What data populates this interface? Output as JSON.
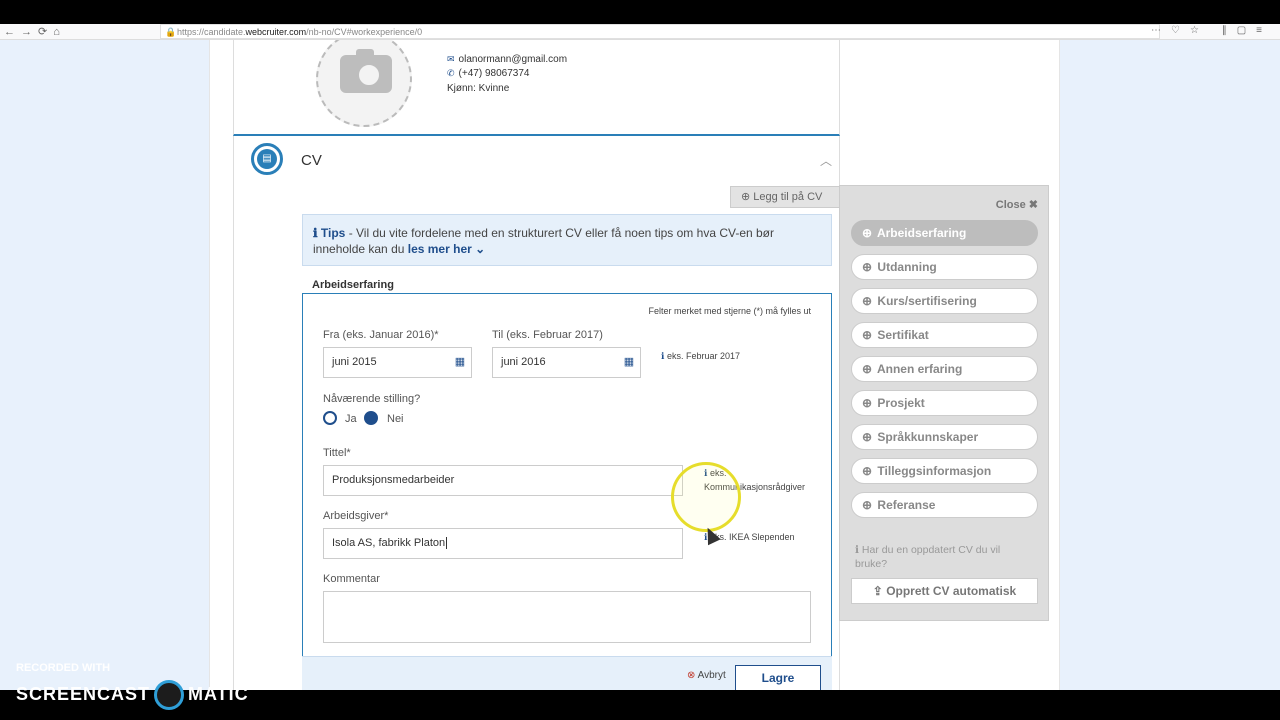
{
  "browser": {
    "url_prefix": "https://candidate.",
    "url_domain": "webcruiter.com",
    "url_path": "/nb-no/CV#workexperience/0"
  },
  "profile": {
    "email": "olanormann@gmail.com",
    "phone": "(+47) 98067374",
    "gender": "Kjønn: Kvinne"
  },
  "cv": {
    "title": "CV",
    "add_button": "Legg til på CV"
  },
  "tips": {
    "label": "Tips",
    "text": " - Vil du vite fordelene med en strukturert CV eller få noen tips om hva CV-en bør inneholde kan du ",
    "link": "les mer her"
  },
  "form": {
    "section_title": "Arbeidserfaring",
    "required_note": "Felter merket med stjerne (*) må fylles ut",
    "from_label": "Fra (eks. Januar 2016)*",
    "from_value": "juni 2015",
    "to_label": "Til (eks. Februar 2017)",
    "to_value": "juni 2016",
    "date_hint": "eks. Februar 2017",
    "current_label": "Nåværende stilling?",
    "radio_yes": "Ja",
    "radio_no": "Nei",
    "radio_selected": "Nei",
    "title_label": "Tittel*",
    "title_value": "Produksjonsmedarbeider",
    "title_hint_1": "eks.",
    "title_hint_2": "Kommunikasjonsrådgiver",
    "employer_label": "Arbeidsgiver*",
    "employer_value": "Isola AS, fabrikk Platon",
    "employer_hint": "eks. IKEA Slependen",
    "comment_label": "Kommentar",
    "cancel": "Avbryt",
    "save": "Lagre"
  },
  "side_panel": {
    "close": "Close",
    "items": [
      {
        "label": "Arbeidserfaring",
        "active": true
      },
      {
        "label": "Utdanning",
        "active": false
      },
      {
        "label": "Kurs/sertifisering",
        "active": false
      },
      {
        "label": "Sertifikat",
        "active": false
      },
      {
        "label": "Annen erfaring",
        "active": false
      },
      {
        "label": "Prosjekt",
        "active": false
      },
      {
        "label": "Språkkunnskaper",
        "active": false
      },
      {
        "label": "Tilleggsinformasjon",
        "active": false
      },
      {
        "label": "Referanse",
        "active": false
      }
    ],
    "question": "Har du en oppdatert CV du vil bruke?",
    "create_button": "Opprett CV automatisk"
  },
  "watermark": {
    "line1": "RECORDED WITH",
    "line2a": "SCREENCAST",
    "line2b": "MATIC"
  },
  "colors": {
    "accent": "#2a7fb8",
    "primary": "#1f4e8c",
    "page_bg": "#e8f1fc"
  }
}
